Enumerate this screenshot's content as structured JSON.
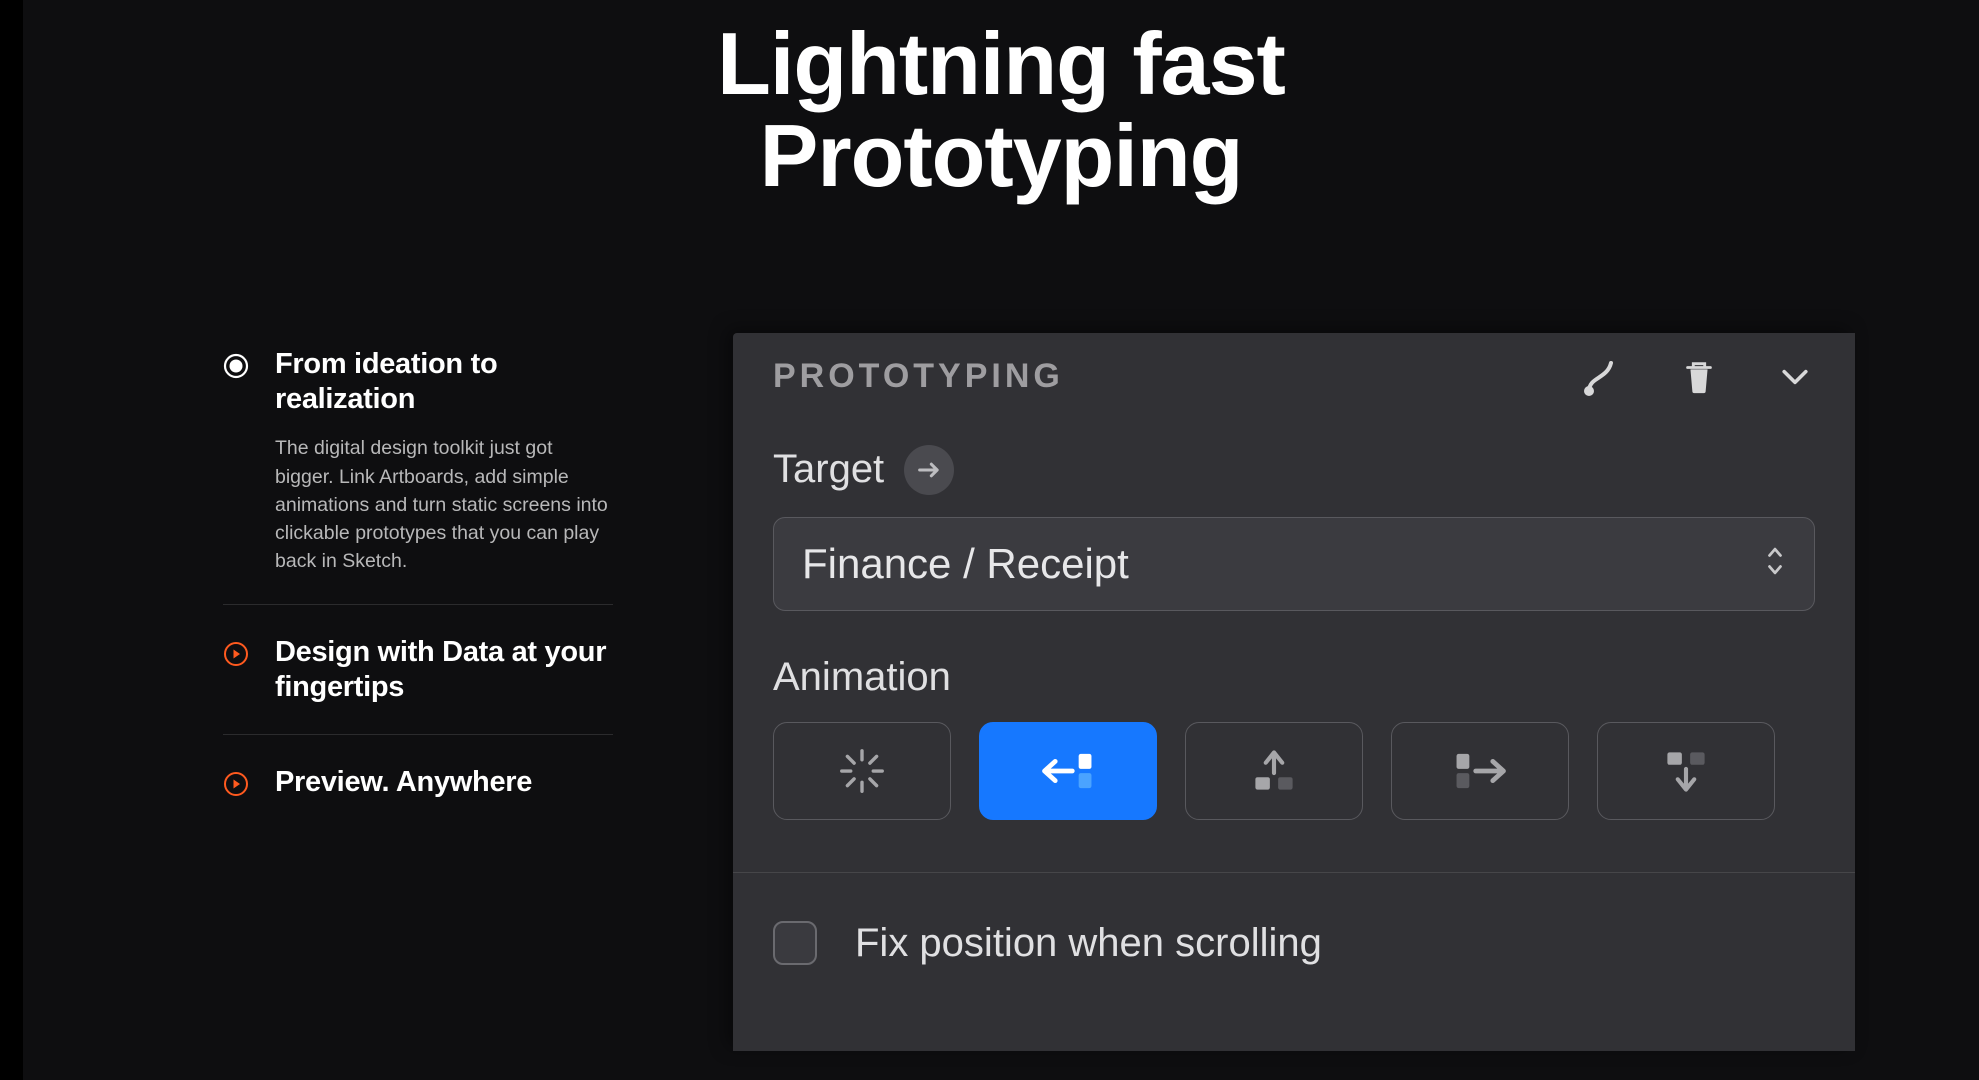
{
  "hero": {
    "line1": "Lightning fast",
    "line2": "Prototyping"
  },
  "features": [
    {
      "title": "From ideation to realization",
      "desc": "The digital design toolkit just got bigger. Link Artboards, add simple animations and turn static screens into clickable prototypes that you can play back in Sketch.",
      "active": true
    },
    {
      "title": "Design with Data at your fingertips",
      "active": false
    },
    {
      "title": "Preview. Anywhere",
      "active": false
    }
  ],
  "panel": {
    "title": "PROTOTYPING",
    "target_label": "Target",
    "target_value": "Finance / Receipt",
    "animation_label": "Animation",
    "animation_buttons": [
      {
        "name": "none",
        "active": false
      },
      {
        "name": "slide-left",
        "active": true
      },
      {
        "name": "slide-up",
        "active": false
      },
      {
        "name": "slide-right",
        "active": false
      },
      {
        "name": "slide-down",
        "active": false
      }
    ],
    "fix_label": "Fix position when scrolling"
  },
  "colors": {
    "accent": "#ff5a1f",
    "blue": "#1678ff"
  }
}
